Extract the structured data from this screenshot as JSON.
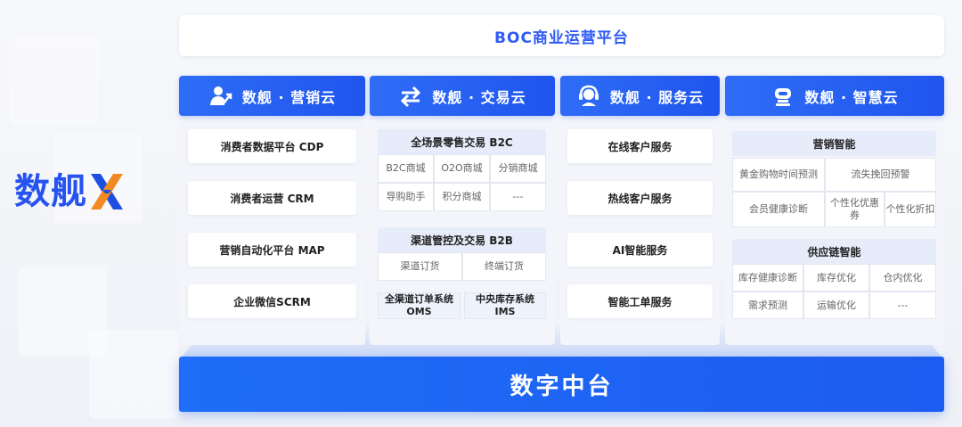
{
  "logo": {
    "text": "数舰",
    "mark": "x-logo-icon"
  },
  "top_banner": "BOC商业运营平台",
  "platform": "数字中台",
  "colors": {
    "brand_blue": "#1f5cf0",
    "banner_text": "#2e5bf5",
    "panel_bg": "#f3f5fa"
  },
  "columns": [
    {
      "title": "数舰 · 营销云",
      "icon": "user-growth-icon",
      "items": [
        "消费者数据平台 CDP",
        "消费者运营 CRM",
        "营销自动化平台 MAP",
        "企业微信SCRM"
      ]
    },
    {
      "title": "数舰 · 交易云",
      "icon": "exchange-arrows-icon",
      "groups": [
        {
          "title": "全场景零售交易 B2C",
          "cells": [
            "B2C商城",
            "O2O商城",
            "分销商城",
            "导购助手",
            "积分商城",
            "---"
          ]
        },
        {
          "title": "渠道管控及交易 B2B",
          "cells": [
            "渠道订货",
            "终端订货"
          ]
        }
      ],
      "systems": [
        {
          "line1": "全渠道订单系统",
          "line2": "OMS"
        },
        {
          "line1": "中央库存系统",
          "line2": "IMS"
        }
      ]
    },
    {
      "title": "数舰 · 服务云",
      "icon": "headset-icon",
      "items": [
        "在线客户服务",
        "热线客户服务",
        "AI智能服务",
        "智能工单服务"
      ]
    },
    {
      "title": "数舰 · 智慧云",
      "icon": "robot-icon",
      "groups": [
        {
          "title": "营销智能",
          "cells": [
            "黄金购物时间预测",
            "流失挽回预警",
            "会员健康诊断",
            "个性化优惠券",
            "个性化折扣"
          ]
        },
        {
          "title": "供应链智能",
          "cells": [
            "库存健康诊断",
            "库存优化",
            "仓内优化",
            "需求预测",
            "运输优化",
            "---"
          ]
        }
      ]
    }
  ]
}
